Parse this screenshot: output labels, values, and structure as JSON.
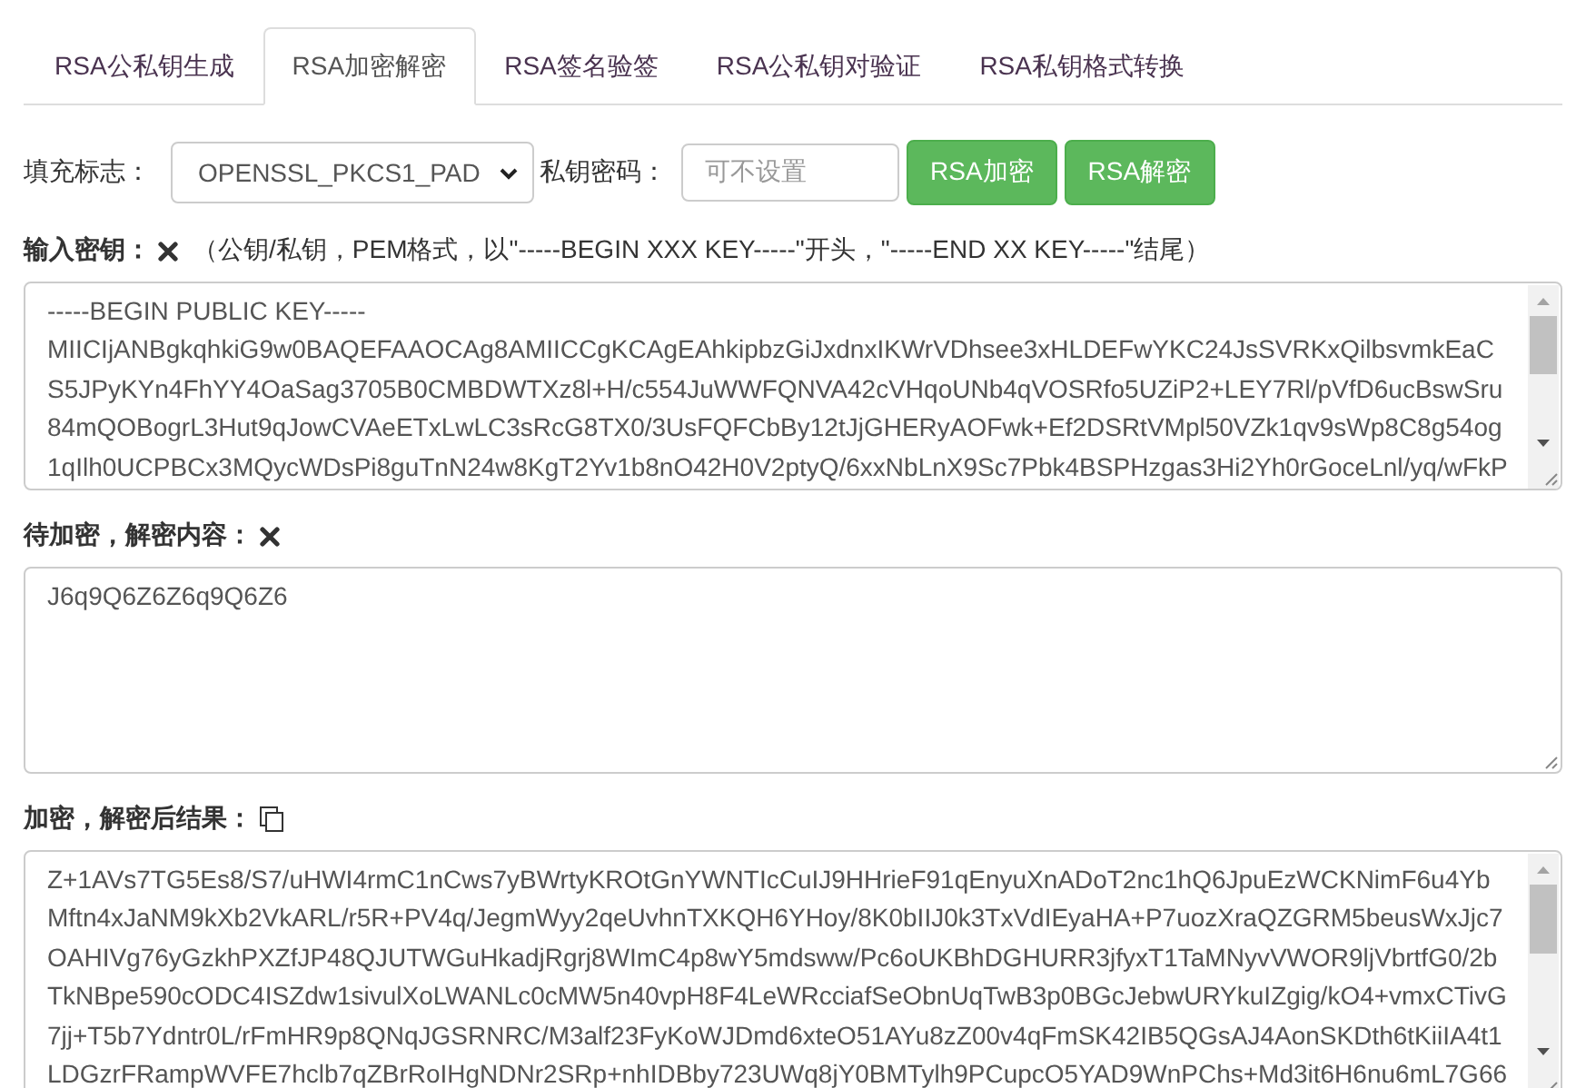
{
  "tabs": [
    {
      "label": "RSA公私钥生成",
      "selected": false
    },
    {
      "label": "RSA加密解密",
      "selected": true
    },
    {
      "label": "RSA签名验签",
      "selected": false
    },
    {
      "label": "RSA公私钥对验证",
      "selected": false
    },
    {
      "label": "RSA私钥格式转换",
      "selected": false
    }
  ],
  "toolbar": {
    "padding_label": "填充标志：",
    "padding_value": "OPENSSL_PKCS1_PAD",
    "password_label": "私钥密码：",
    "password_placeholder": "可不设置",
    "buttons": [
      "RSA加密",
      "RSA解密"
    ]
  },
  "key_input": {
    "label": "输入密钥：",
    "hint": "（公钥/私钥，PEM格式，以\"-----BEGIN XXX KEY-----\"开头，\"-----END XX KEY-----\"结尾）",
    "value": [
      "-----BEGIN PUBLIC KEY-----",
      "MIICIjANBgkqhkiG9w0BAQEFAAOCAg8AMIICCgKCAgEAhkipbzGiJxdnxIKWrVDhsee3xHLDEFwYKC24JsSVRKxQilbsvmkEaC",
      "S5JPyKYn4FhYY4OaSag3705B0CMBDWTXz8l+H/c554JuWWFQNVA42cVHqoUNb4qVOSRfo5UZiP2+LEY7Rl/pVfD6ucBswSru",
      "84mQOBogrL3Hut9qJowCVAeETxLwLC3sRcG8TX0/3UsFQFCbBy12tJjGHERyAOFwk+Ef2DSRtVMpl50VZk1qv9sWp8C8g54og",
      "1qIlh0UCPBCx3MQycWDsPi8guTnN24w8KgT2Yv1b8nO42H0V2ptyQ/6xxNbLnX9Sc7Pbk4BSPHzgas3Hi2Yh0rGoceLnl/yq/wFkP"
    ]
  },
  "content_input": {
    "label": "待加密，解密内容：",
    "value": [
      "J6q9Q6Z6Z6q9Q6Z6"
    ]
  },
  "result": {
    "label": "加密，解密后结果：",
    "value": [
      "Z+1AVs7TG5Es8/S7/uHWI4rmC1nCws7yBWrtyKROtGnYWNTIcCuIJ9HHrieF91qEnyuXnADoT2nc1hQ6JpuEzWCKNimF6u4Yb",
      "Mftn4xJaNM9kXb2VkARL/r5R+PV4q/JegmWyy2qeUvhnTXKQH6YHoy/8K0bIIJ0k3TxVdIEyaHA+P7uozXraQZGRM5beusWxJjc7",
      "OAHIVg76yGzkhPXZfJP48QJUTWGuHkadjRgrj8WImC4p8wY5mdsww/Pc6oUKBhDGHURR3jfyxT1TaMNyvVWOR9ljVbrtfG0/2b",
      "TkNBpe590cODC4ISZdw1sivulXoLWANLc0cMW5n40vpH8F4LeWRcciafSeObnUqTwB3p0BGcJebwURYkuIZgig/kO4+vmxCTivG",
      "7jj+T5b7Ydntr0L/rFmHR9p8QNqJGSRNRC/M3alf23FyKoWJDmd6xteO51AYu8zZ00v4qFmSK42IB5QGsAJ4AonSKDth6tKiiIA4t1",
      "LDGzrFRampWVFE7hclb7qZBrRoIHgNDNr2SRp+nhIDBby723UWq8jY0BMTylh9PCupcO5YAD9WnPChs+Md3it6H6nu6mL7G66"
    ]
  }
}
